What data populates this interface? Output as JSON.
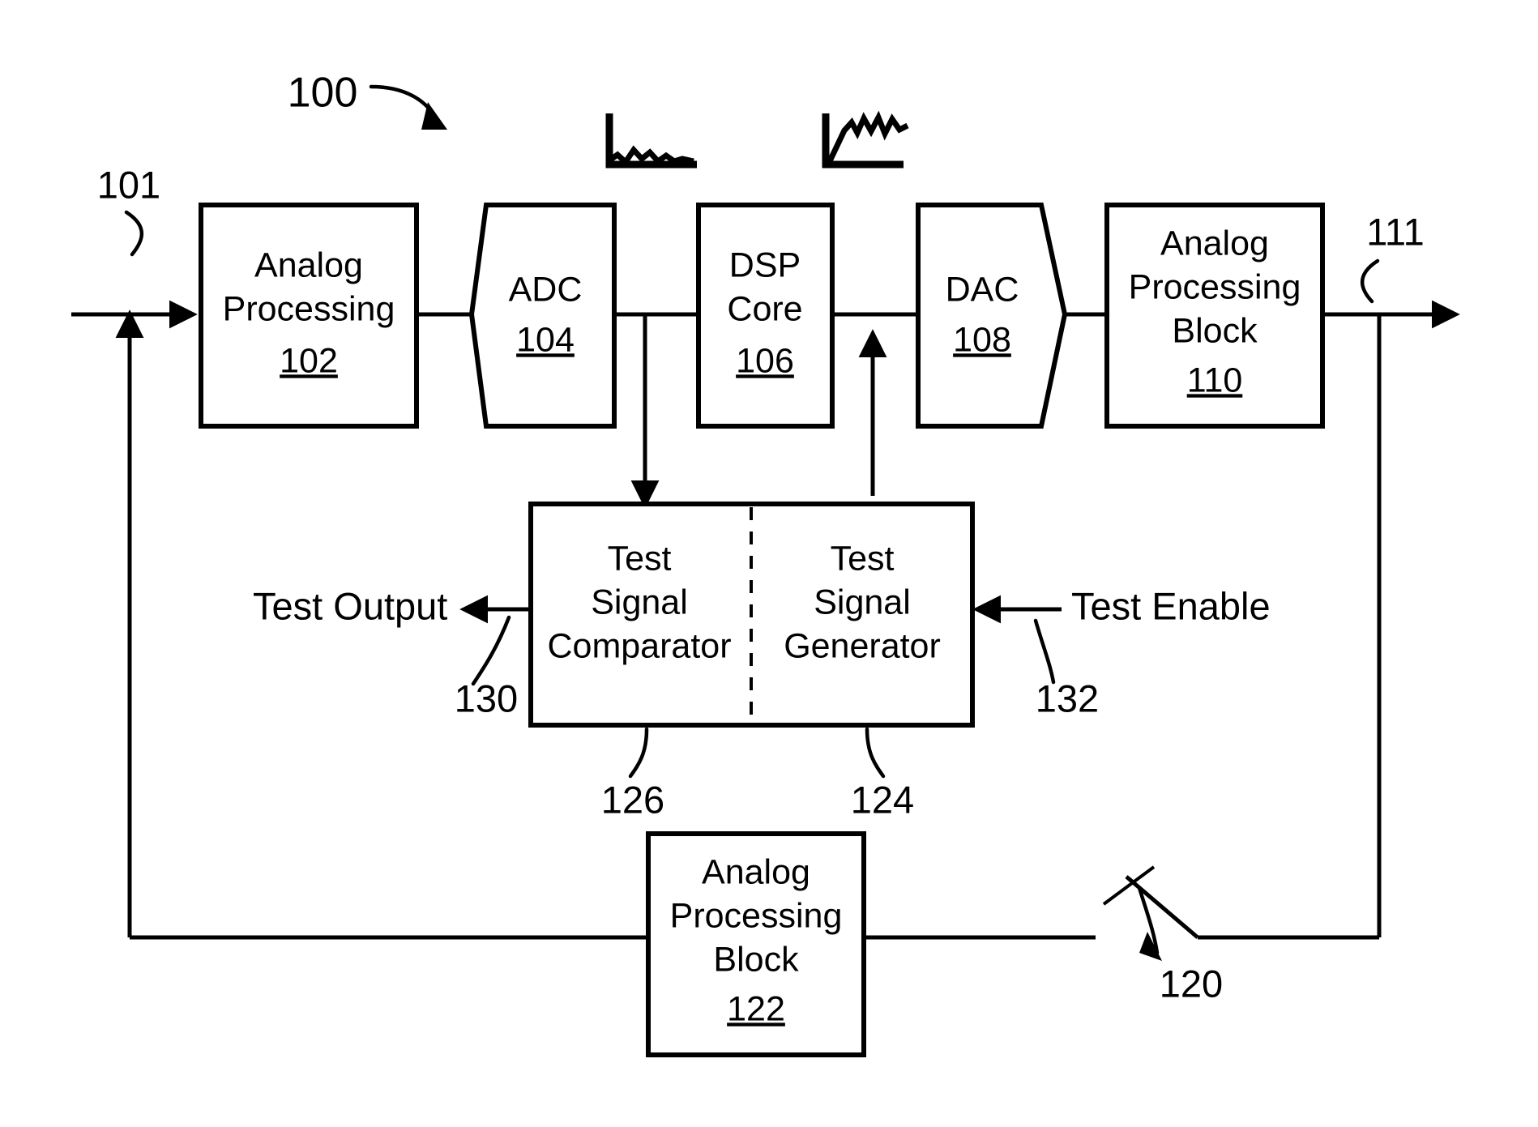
{
  "figure": {
    "number": "100",
    "title_ref": "100"
  },
  "signals": {
    "input_ref": "101",
    "output_ref": "111",
    "test_output_label": "Test Output",
    "test_enable_label": "Test Enable",
    "test_output_ref": "130",
    "test_enable_ref": "132",
    "switch_ref": "120",
    "comparator_ref": "126",
    "generator_ref": "124"
  },
  "blocks": [
    {
      "id": "analog-processing-102",
      "shape": "rect",
      "lines": [
        "Analog",
        "Processing"
      ],
      "ref": "102"
    },
    {
      "id": "adc-104",
      "shape": "pentagon-left-notch",
      "lines": [
        "ADC"
      ],
      "ref": "104"
    },
    {
      "id": "dsp-core-106",
      "shape": "rect",
      "lines": [
        "DSP",
        "Core"
      ],
      "ref": "106"
    },
    {
      "id": "dac-108",
      "shape": "pentagon-right-point",
      "lines": [
        "DAC"
      ],
      "ref": "108"
    },
    {
      "id": "analog-processing-block-110",
      "shape": "rect",
      "lines": [
        "Analog",
        "Processing",
        "Block"
      ],
      "ref": "110"
    },
    {
      "id": "analog-processing-block-122",
      "shape": "rect",
      "lines": [
        "Analog",
        "Processing",
        "Block"
      ],
      "ref": "122"
    }
  ],
  "test_block": {
    "left_half": {
      "id": "test-signal-comparator-126",
      "lines": [
        "Test",
        "Signal",
        "Comparator"
      ]
    },
    "right_half": {
      "id": "test-signal-generator-124",
      "lines": [
        "Test",
        "Signal",
        "Generator"
      ]
    }
  },
  "icons": [
    {
      "id": "noise-spectrum-icon",
      "name": "noise-spectrum-plot-icon",
      "description": "small plot with vertical axis and low jagged noise trace along the baseline"
    },
    {
      "id": "settling-waveform-icon",
      "name": "settling-waveform-plot-icon",
      "description": "small plot with vertical axis and rising trace with damped ringing settling flat"
    }
  ],
  "colors": {
    "stroke": "#000000",
    "background": "#ffffff"
  }
}
